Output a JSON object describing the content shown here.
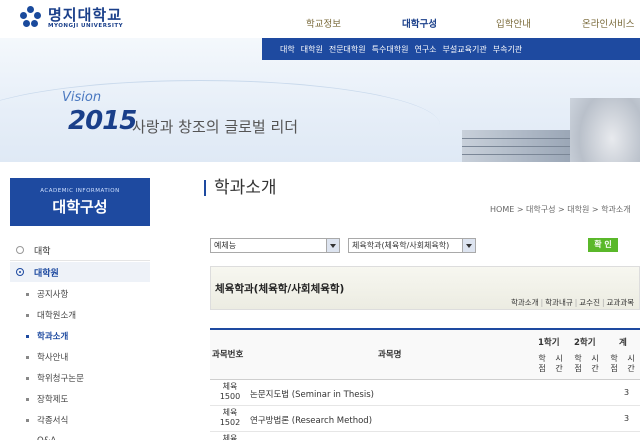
{
  "header": {
    "logo_ko": "명지대학교",
    "logo_en": "MYONGJI UNIVERSITY",
    "gnb": [
      "학교정보",
      "대학구성",
      "입학안내",
      "온라인서비스"
    ],
    "subnav": [
      "대학",
      "대학원",
      "전문대학원",
      "특수대학원",
      "연구소",
      "부설교육기관",
      "부속기관"
    ]
  },
  "banner": {
    "vision": "Vision",
    "year": "2015",
    "slogan": "사랑과 창조의 글로벌 리더"
  },
  "lnb": {
    "small": "ACADEMIC INFORMATION",
    "title": "대학구성",
    "items": [
      "대학",
      "대학원"
    ],
    "subs": [
      "공지사항",
      "대학원소개",
      "학과소개",
      "학사안내",
      "학위청구논문",
      "장학제도",
      "각종서식",
      "Q&A"
    ]
  },
  "main": {
    "title": "학과소개",
    "breadcrumb": "HOME > 대학구성 > 대학원 > 학과소개",
    "select1": "예체능",
    "select2": "체육학과(체육학/사회체육학)",
    "ok": "확 인",
    "dept": "체육학과(체육학/사회체육학)",
    "tabs": [
      "학과소개",
      "학과내규",
      "교수진",
      "교과과목"
    ]
  },
  "table": {
    "h_code": "과목번호",
    "h_name": "과목명",
    "h_sem1": "1학기",
    "h_sem2": "2학기",
    "h_total": "계",
    "h_credit": "학점",
    "h_hour": "시간",
    "rows": [
      {
        "code": "체육1500",
        "name": "논문지도법 (Seminar in Thesis)",
        "credit": "3"
      },
      {
        "code": "체육1502",
        "name": "연구방법론 (Research Method)",
        "credit": "3"
      },
      {
        "code": "체육",
        "name": "",
        "credit": ""
      }
    ]
  },
  "colors": {
    "brand": "#1e4aa0",
    "ok_button": "#5ab82a"
  }
}
